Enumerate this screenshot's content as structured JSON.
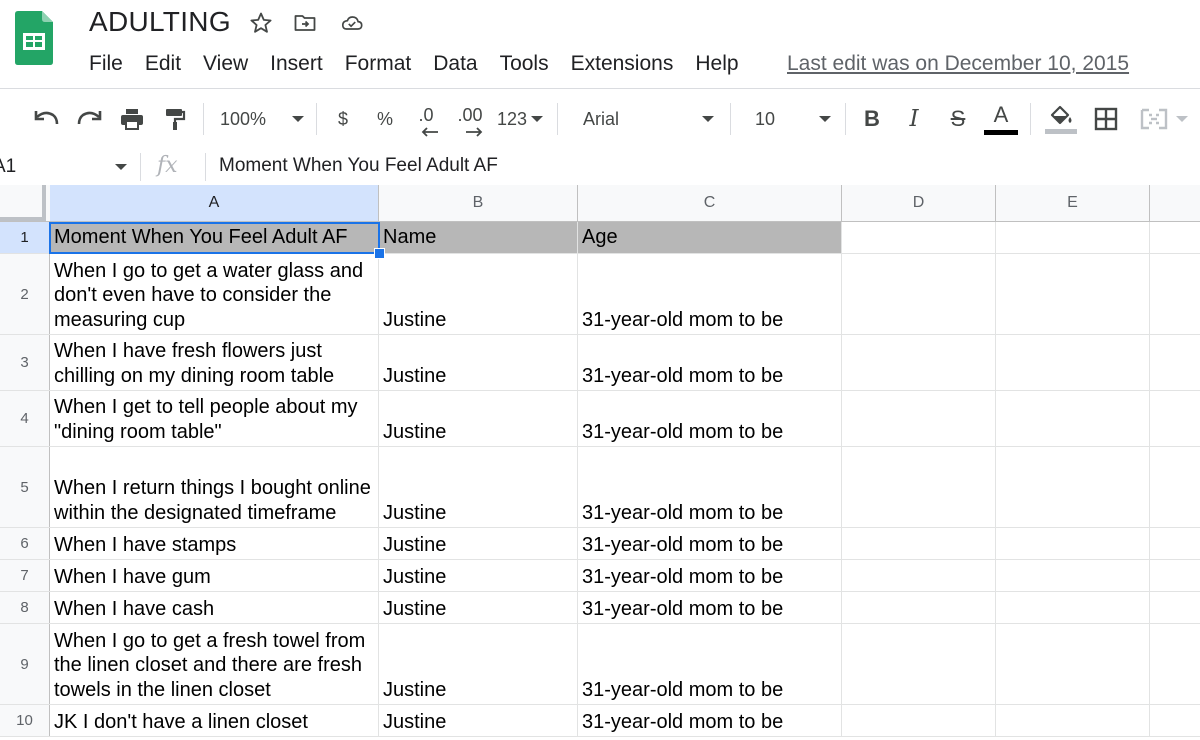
{
  "doc": {
    "title": "ADULTING",
    "last_edit": "Last edit was on December 10, 2015"
  },
  "menu": [
    "File",
    "Edit",
    "View",
    "Insert",
    "Format",
    "Data",
    "Tools",
    "Extensions",
    "Help"
  ],
  "toolbar": {
    "zoom": "100%",
    "currency": "$",
    "percent": "%",
    "decrease_decimals": ".0",
    "increase_decimals": ".00",
    "more_formats": "123",
    "font": "Arial",
    "font_size": "10",
    "bold": "B",
    "italic": "I",
    "strike": "S",
    "text_color_glyph": "A",
    "text_color": "#000000"
  },
  "formula_bar": {
    "name_box": "A1",
    "fx": "fx",
    "value": "Moment When You Feel Adult AF"
  },
  "grid": {
    "columns": [
      "A",
      "B",
      "C",
      "D",
      "E"
    ],
    "selected_cell": "A1",
    "header_fill": "#b7b7b7",
    "rows": [
      {
        "num": "1",
        "a": "Moment When You Feel Adult AF",
        "b": "Name",
        "c": "Age"
      },
      {
        "num": "2",
        "a": "When I go to get a water glass and don't even have to consider the measuring cup",
        "b": "Justine",
        "c": "31-year-old mom to be"
      },
      {
        "num": "3",
        "a": "When I have fresh flowers just chilling on my dining room table",
        "b": "Justine",
        "c": "31-year-old mom to be"
      },
      {
        "num": "4",
        "a": "When I get to tell people about my \"dining room table\"",
        "b": "Justine",
        "c": "31-year-old mom to be"
      },
      {
        "num": "5",
        "a": "When I return things I bought online within the designated timeframe",
        "b": "Justine",
        "c": "31-year-old mom to be"
      },
      {
        "num": "6",
        "a": "When I have stamps",
        "b": "Justine",
        "c": "31-year-old mom to be"
      },
      {
        "num": "7",
        "a": "When I have gum",
        "b": "Justine",
        "c": "31-year-old mom to be"
      },
      {
        "num": "8",
        "a": "When I have cash",
        "b": "Justine",
        "c": "31-year-old mom to be"
      },
      {
        "num": "9",
        "a": "When I go to get a fresh towel from the linen closet and there are fresh towels in the linen closet",
        "b": "Justine",
        "c": "31-year-old mom to be"
      },
      {
        "num": "10",
        "a": "JK I don't have a linen closet",
        "b": "Justine",
        "c": "31-year-old mom to be"
      }
    ]
  }
}
